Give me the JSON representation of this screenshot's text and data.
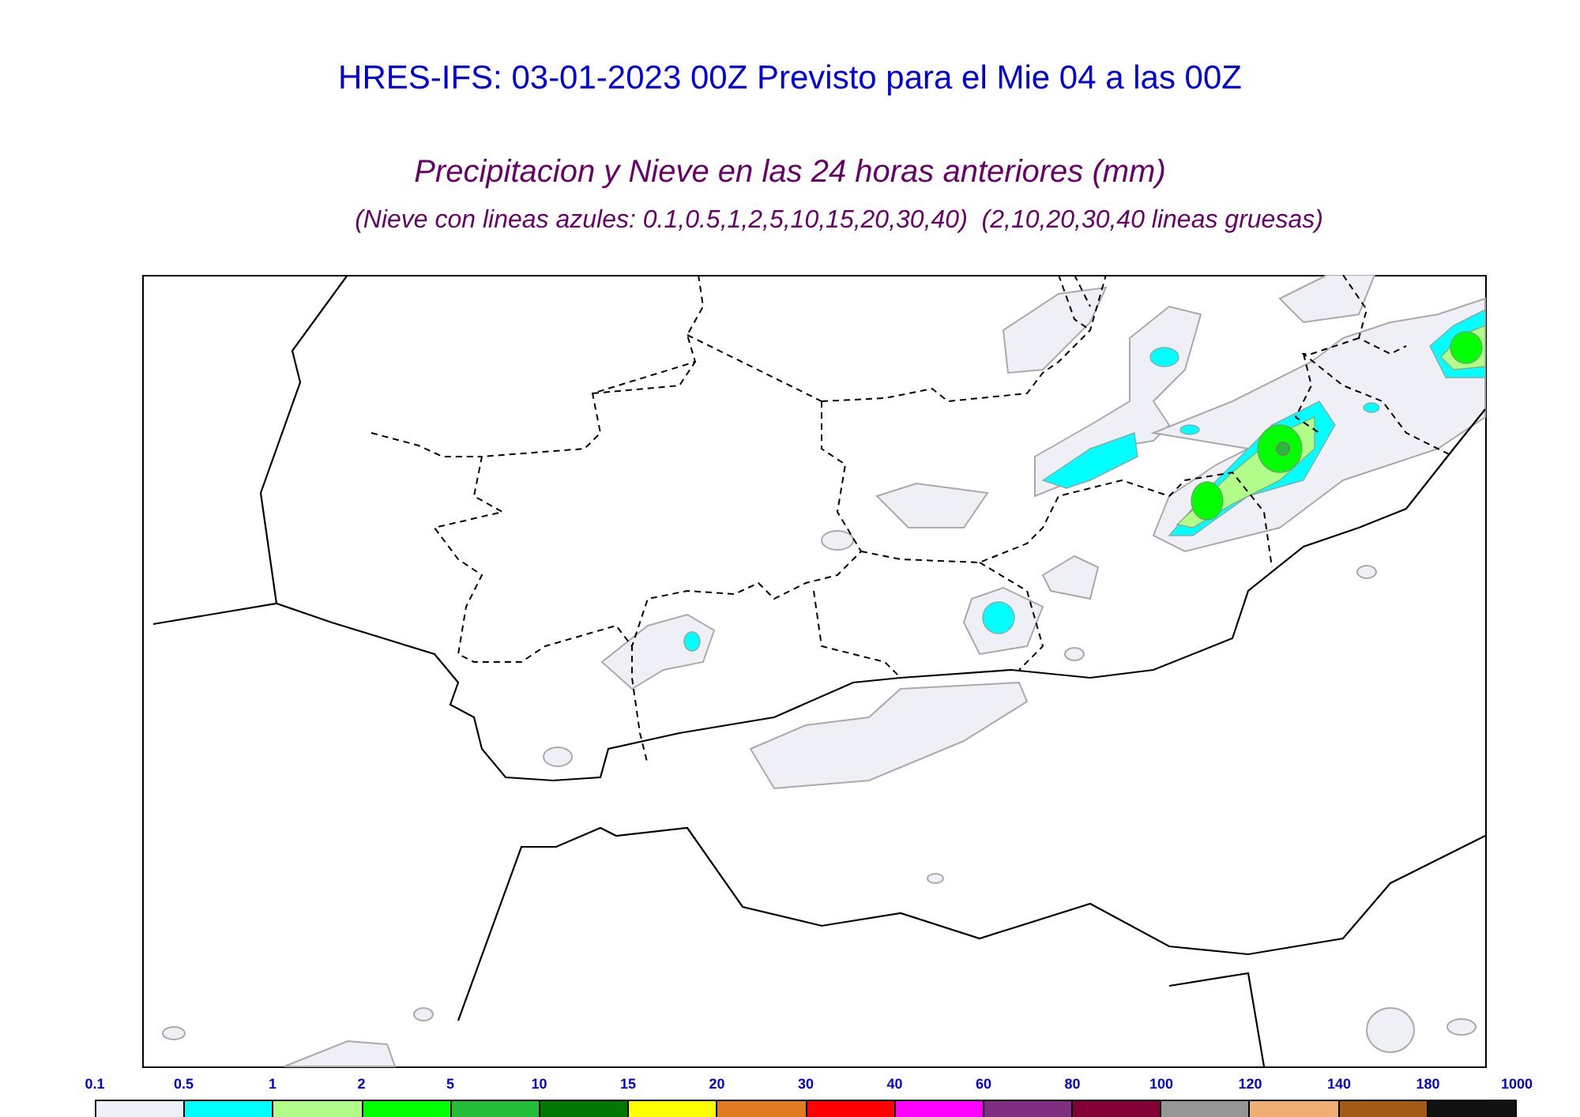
{
  "title": "HRES-IFS: 03-01-2023 00Z Previsto para el Mie 04 a las 00Z",
  "subtitle": "Precipitacion y Nieve en las 24 horas anteriores (mm)",
  "note": "(Nieve con lineas azules: 0.1,0.5,1,2,5,10,15,20,30,40)  (2,10,20,30,40 lineas gruesas)",
  "legend": {
    "labels": [
      "0.1",
      "0.5",
      "1",
      "2",
      "5",
      "10",
      "15",
      "20",
      "30",
      "40",
      "60",
      "80",
      "100",
      "120",
      "140",
      "180",
      "1000"
    ],
    "bins": [
      {
        "color": "#eff0f5"
      },
      {
        "color": "#00ffff"
      },
      {
        "color": "#b2fd8a"
      },
      {
        "color": "#00ff00"
      },
      {
        "color": "#24bd3a"
      },
      {
        "color": "#007800"
      },
      {
        "color": "#ffff00"
      },
      {
        "color": "#e07b21"
      },
      {
        "color": "#ff0000"
      },
      {
        "color": "#ff00ff"
      },
      {
        "color": "#7e2f80"
      },
      {
        "color": "#820034"
      },
      {
        "color": "#969696"
      },
      {
        "color": "#f0ad74"
      },
      {
        "color": "#a35a16"
      },
      {
        "color": "#111111"
      }
    ]
  }
}
